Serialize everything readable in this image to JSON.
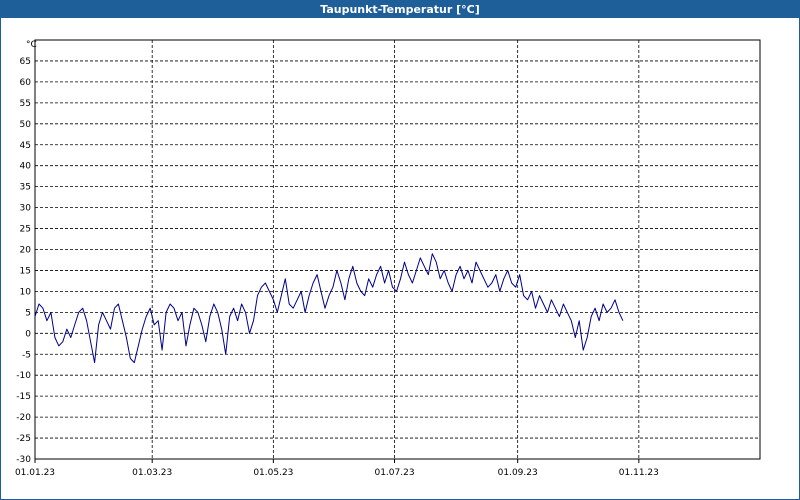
{
  "window": {
    "title": "Taupunkt-Temperatur [°C]"
  },
  "colors": {
    "titlebar": "#1f5f99",
    "series": "#00008b",
    "grid": "#000000"
  },
  "chart_data": {
    "type": "line",
    "title": "Taupunkt-Temperatur [°C]",
    "y_unit_label": "°C",
    "ylim": [
      -30,
      70
    ],
    "y_ticks": [
      "65",
      "60",
      "55",
      "50",
      "45",
      "40",
      "35",
      "30",
      "25",
      "20",
      "15",
      "10",
      "5",
      "0",
      "-5",
      "-10",
      "-15",
      "-20",
      "-25",
      "-30"
    ],
    "x_ticks": [
      "01.01.23",
      "01.03.23",
      "01.05.23",
      "01.07.23",
      "01.09.23",
      "01.11.23"
    ],
    "x_range_days": [
      0,
      365
    ],
    "grid": true,
    "series": [
      {
        "sample_days": 2,
        "values": [
          4,
          7,
          6,
          3,
          5,
          -1,
          -3,
          -2,
          1,
          -1,
          2,
          5,
          6,
          3,
          -2,
          -7,
          2,
          5,
          3,
          1,
          6,
          7,
          3,
          -1,
          -6,
          -7,
          -3,
          1,
          4,
          6,
          2,
          3,
          -4,
          5,
          7,
          6,
          3,
          5,
          -3,
          2,
          6,
          5,
          2,
          -2,
          4,
          7,
          5,
          1,
          -5,
          4,
          6,
          3,
          7,
          5,
          0,
          3,
          9,
          11,
          12,
          10,
          8,
          5,
          9,
          13,
          7,
          6,
          8,
          10,
          5,
          9,
          12,
          14,
          10,
          6,
          9,
          11,
          15,
          12,
          8,
          13,
          16,
          12,
          10,
          9,
          13,
          11,
          14,
          16,
          12,
          15,
          11,
          10,
          13,
          17,
          14,
          12,
          15,
          18,
          16,
          14,
          19,
          17,
          13,
          15,
          12,
          10,
          14,
          16,
          13,
          15,
          12,
          17,
          15,
          13,
          11,
          12,
          14,
          10,
          13,
          15,
          12,
          11,
          14,
          9,
          8,
          10,
          6,
          9,
          7,
          5,
          8,
          6,
          4,
          7,
          5,
          3,
          -1,
          3,
          -4,
          -1,
          4,
          6,
          3,
          7,
          5,
          6,
          8,
          5,
          3
        ]
      }
    ]
  }
}
